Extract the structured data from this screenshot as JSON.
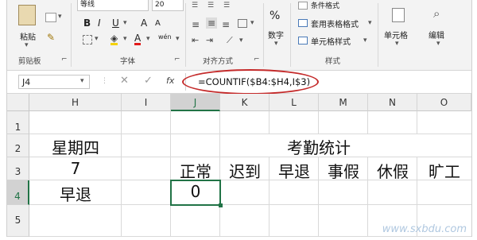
{
  "ribbon": {
    "paste": "粘贴",
    "clipboard_group": "剪贴板",
    "font_name": "等线",
    "font_size": "20",
    "bold": "B",
    "italic": "I",
    "underline": "U",
    "grow_font": "A",
    "shrink_font": "A",
    "font_color": "A",
    "wen": "wén",
    "font_group": "字体",
    "align_group": "对齐方式",
    "number_icon": "%",
    "number_label": "数字",
    "cond_format": "条件格式",
    "table_format": "套用表格格式",
    "cell_style": "单元格样式",
    "style_group": "样式",
    "cells_label": "单元格",
    "edit_label": "编辑"
  },
  "formula_bar": {
    "name_box": "J4",
    "fx": "fx",
    "formula": "=COUNTIF($B4:$H4,I$3)"
  },
  "columns": [
    "H",
    "I",
    "J",
    "K",
    "L",
    "M",
    "N",
    "O"
  ],
  "rows": [
    "1",
    "2",
    "3",
    "4",
    "5"
  ],
  "cells": {
    "h2": "星期四",
    "h3": "7",
    "h4": "早退",
    "title": "考勤统计",
    "j3": "正常",
    "k3": "迟到",
    "l3": "早退",
    "m3": "事假",
    "n3": "休假",
    "o3": "旷工",
    "j4": "0"
  },
  "watermark": "www.sxbdu.com",
  "colors": {
    "select": "#217346",
    "annotation": "#c42a2a"
  }
}
